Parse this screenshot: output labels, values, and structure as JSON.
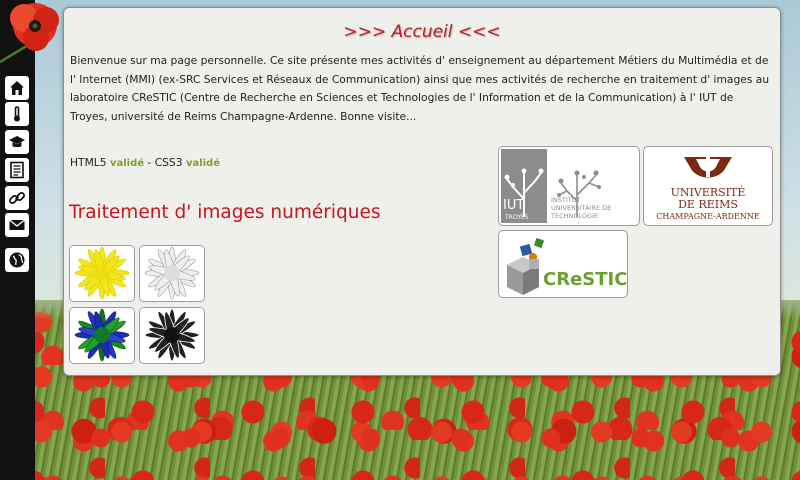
{
  "header": {
    "title": ">>> Accueil <<<"
  },
  "intro": {
    "text": "Bienvenue sur ma page personnelle. Ce site présente mes activités d' enseignement au département Métiers du Multimédia et de l' Internet (MMI) (ex-SRC Services et Réseaux de Communication) ainsi que mes activités de recherche en traitement d' images au laboratoire CReSTIC (Centre de Recherche en Sciences et Technologies de l' Information et de la Communication) à l' IUT de Troyes, université de Reims Champagne-Ardenne. Bonne visite..."
  },
  "validity": {
    "html_label": "HTML5",
    "html_status": "validé",
    "separator": "-",
    "css_label": "CSS3",
    "css_status": "validé"
  },
  "section": {
    "title": "Traitement d' images numériques"
  },
  "sidebar": {
    "items": [
      {
        "icon": "home-icon"
      },
      {
        "icon": "thermometer-icon"
      },
      {
        "icon": "graduation-cap-icon"
      },
      {
        "icon": "document-icon"
      },
      {
        "icon": "link-icon"
      },
      {
        "icon": "mail-icon"
      },
      {
        "icon": "globe-icon"
      }
    ]
  },
  "partners": {
    "iut": {
      "line1": "IUT",
      "line2": "TROYES",
      "text1": "INSTITUT",
      "text2": "UNIVERSITAIRE DE",
      "text3": "TECHNOLOGIE"
    },
    "urca": {
      "line1": "UNIVERSITÉ",
      "line2": "DE REIMS",
      "line3": "CHAMPAGNE-ARDENNE"
    },
    "crestic": {
      "name": "CReSTIC"
    }
  },
  "colors": {
    "accent": "#c7161c",
    "valid": "#7a9b2a",
    "sidebar": "#111111"
  }
}
